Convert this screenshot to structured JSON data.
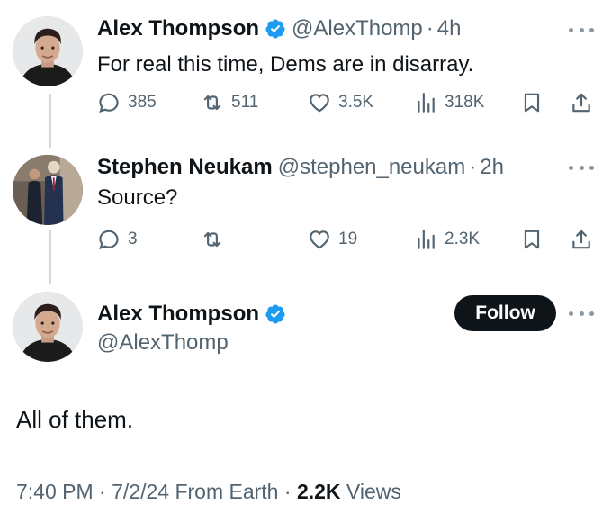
{
  "tweets": [
    {
      "name": "Alex Thompson",
      "handle": "@AlexThomp",
      "time": "4h",
      "text": "For real this time, Dems are in disarray.",
      "replies": "385",
      "retweets": "511",
      "likes": "3.5K",
      "views": "318K"
    },
    {
      "name": "Stephen Neukam",
      "handle": "@stephen_neukam",
      "time": "2h",
      "text": "Source?",
      "replies": "3",
      "retweets": "",
      "likes": "19",
      "views": "2.3K"
    }
  ],
  "main": {
    "name": "Alex Thompson",
    "handle": "@AlexThomp",
    "follow_label": "Follow",
    "text": "All of them.",
    "time": "7:40 PM",
    "date": "7/2/24",
    "source": "From Earth",
    "views_count": "2.2K",
    "views_label": "Views"
  },
  "separator": "·",
  "colors": {
    "verified": "#1d9bf0",
    "text_primary": "#0f1419",
    "text_secondary": "#536471",
    "thread_line": "#cfd9de",
    "follow_bg": "#0f1419"
  },
  "icons": [
    "reply-icon",
    "retweet-icon",
    "like-icon",
    "views-icon",
    "bookmark-icon",
    "share-icon",
    "more-icon",
    "verified-icon"
  ]
}
